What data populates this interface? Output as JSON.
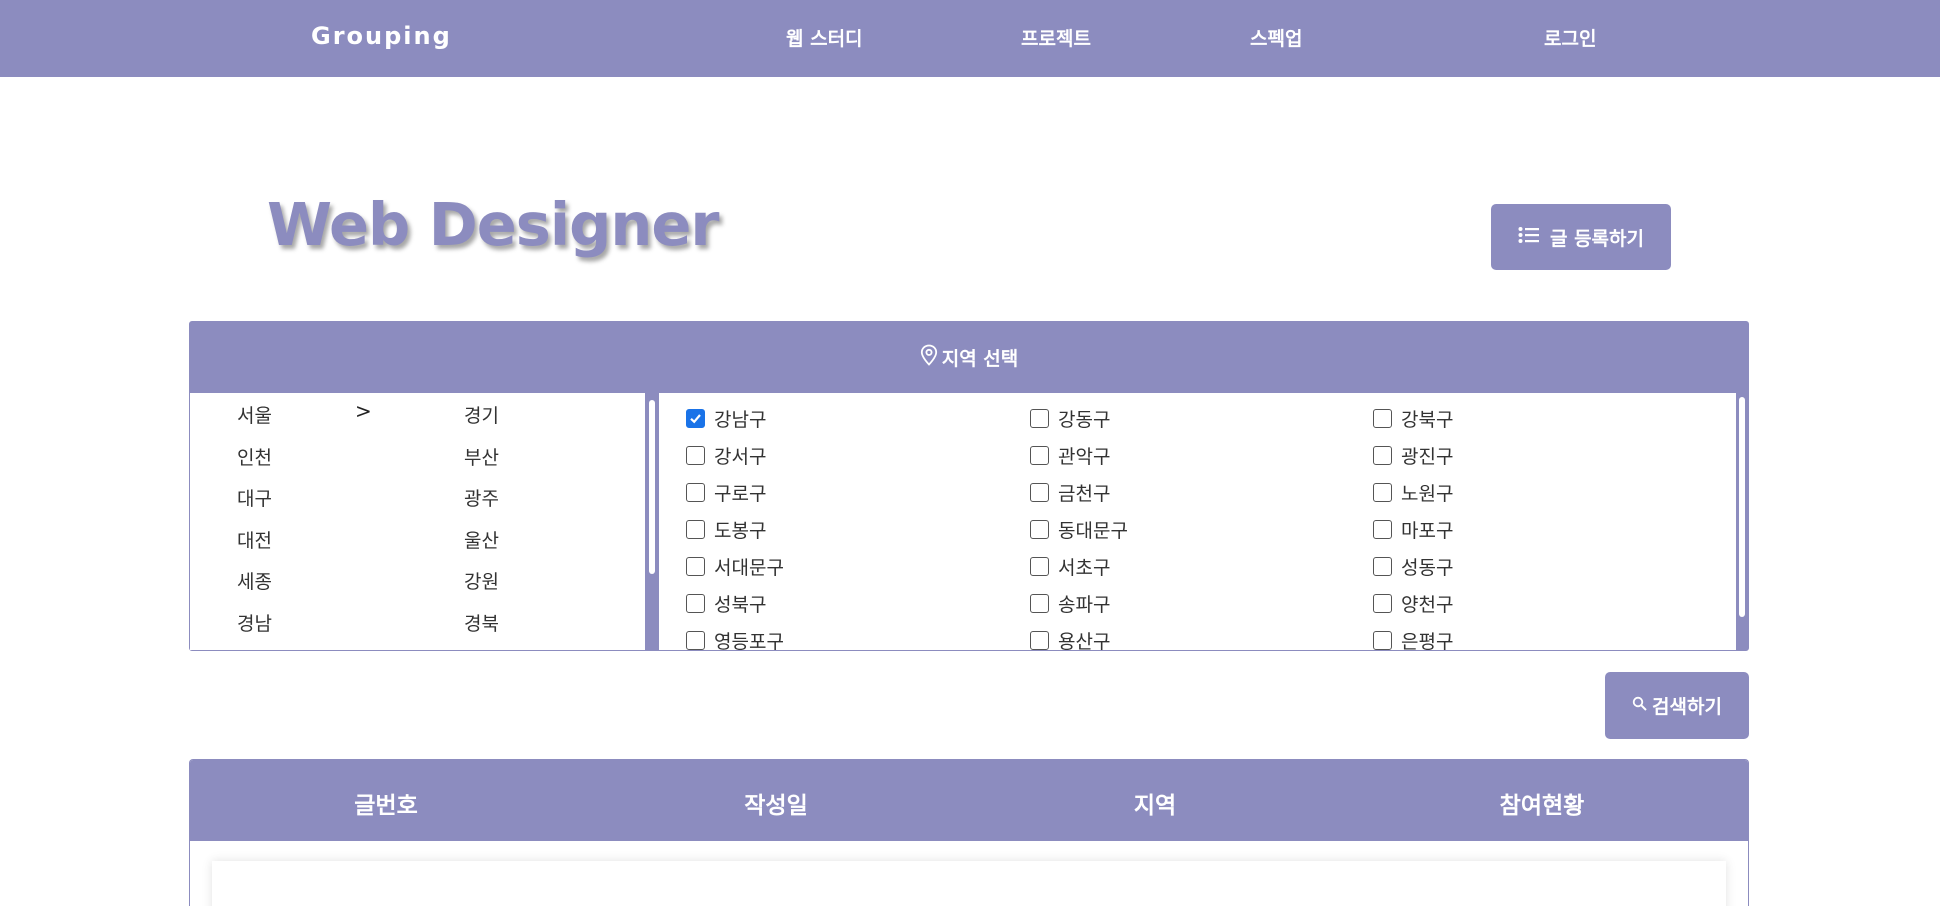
{
  "nav": {
    "brand": "Grouping",
    "links": [
      "웹 스터디",
      "프로젝트",
      "스펙업",
      "로그인"
    ]
  },
  "page": {
    "title": "Web Designer",
    "write_button": "글 등록하기",
    "search_button": "검색하기"
  },
  "region": {
    "header": "지역 선택",
    "provinces": [
      "서울",
      "경기",
      "인천",
      "부산",
      "대구",
      "광주",
      "대전",
      "울산",
      "세종",
      "강원",
      "경남",
      "경북"
    ],
    "selected_province": "서울",
    "districts": [
      {
        "name": "강남구",
        "checked": true
      },
      {
        "name": "강동구",
        "checked": false
      },
      {
        "name": "강북구",
        "checked": false
      },
      {
        "name": "강서구",
        "checked": false
      },
      {
        "name": "관악구",
        "checked": false
      },
      {
        "name": "광진구",
        "checked": false
      },
      {
        "name": "구로구",
        "checked": false
      },
      {
        "name": "금천구",
        "checked": false
      },
      {
        "name": "노원구",
        "checked": false
      },
      {
        "name": "도봉구",
        "checked": false
      },
      {
        "name": "동대문구",
        "checked": false
      },
      {
        "name": "마포구",
        "checked": false
      },
      {
        "name": "서대문구",
        "checked": false
      },
      {
        "name": "서초구",
        "checked": false
      },
      {
        "name": "성동구",
        "checked": false
      },
      {
        "name": "성북구",
        "checked": false
      },
      {
        "name": "송파구",
        "checked": false
      },
      {
        "name": "양천구",
        "checked": false
      },
      {
        "name": "영등포구",
        "checked": false
      },
      {
        "name": "용산구",
        "checked": false
      },
      {
        "name": "은평구",
        "checked": false
      }
    ]
  },
  "table": {
    "headers": [
      "글번호",
      "작성일",
      "지역",
      "참여현황"
    ]
  },
  "icons": {
    "list": "list-icon",
    "location": "map-pin-icon",
    "search": "search-icon",
    "chevron": "chevron-right-icon"
  },
  "colors": {
    "primary": "#8c8cbf",
    "checkbox_checked": "#1a73e8"
  }
}
